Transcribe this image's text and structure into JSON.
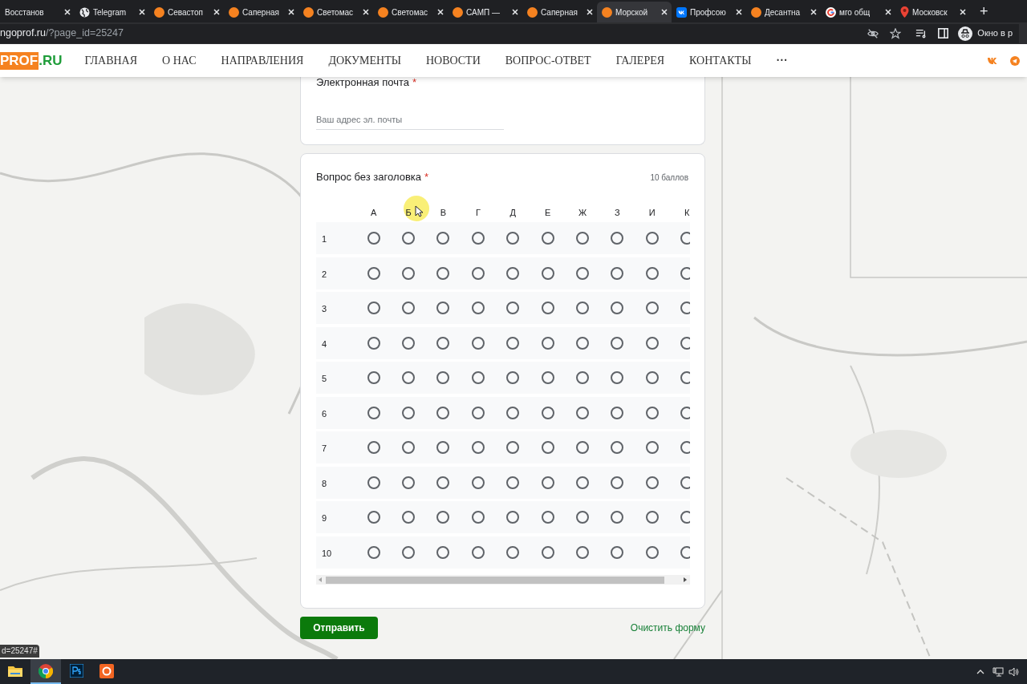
{
  "browser": {
    "tabs": [
      {
        "title": "Восстанов",
        "kind": "none",
        "selected": false
      },
      {
        "title": "Telegram",
        "kind": "globe",
        "selected": false
      },
      {
        "title": "Севастоп",
        "kind": "dot",
        "selected": false
      },
      {
        "title": "Саперная",
        "kind": "dot",
        "selected": false
      },
      {
        "title": "Светомас",
        "kind": "dot",
        "selected": false
      },
      {
        "title": "Светомас",
        "kind": "dot",
        "selected": false
      },
      {
        "title": "САМП —",
        "kind": "dot",
        "selected": false
      },
      {
        "title": "Саперная",
        "kind": "dot",
        "selected": false
      },
      {
        "title": "Морской",
        "kind": "dot",
        "selected": true
      },
      {
        "title": "Профсою",
        "kind": "vk",
        "selected": false
      },
      {
        "title": "Десантна",
        "kind": "dot",
        "selected": false
      },
      {
        "title": "мго общ",
        "kind": "g",
        "selected": false
      },
      {
        "title": "Московск",
        "kind": "pin",
        "selected": false
      }
    ],
    "new_tab": "+",
    "url_host": "ngoprof.ru",
    "url_path": "/?page_id=25247",
    "profile_label": "Окно в р"
  },
  "site": {
    "logo_box": "PROF",
    "logo_rest": ".RU",
    "nav": [
      "ГЛАВНАЯ",
      "О НАС",
      "НАПРАВЛЕНИЯ",
      "ДОКУМЕНТЫ",
      "НОВОСТИ",
      "ВОПРОС-ОТВЕТ",
      "ГАЛЕРЕЯ",
      "КОНТАКТЫ"
    ],
    "more": "···"
  },
  "form": {
    "required_mark": "*",
    "email": {
      "label": "Электронная почта",
      "required": true,
      "placeholder": "Ваш адрес эл. почты"
    },
    "grid": {
      "title": "Вопрос без заголовка",
      "required": true,
      "points": "10 баллов",
      "columns": [
        "А",
        "Б",
        "В",
        "Г",
        "Д",
        "Е",
        "Ж",
        "З",
        "И",
        "К"
      ],
      "rows": [
        {
          "label": "1",
          "checked": [
            false,
            false,
            false,
            false,
            false,
            false,
            false,
            false,
            false,
            false
          ]
        },
        {
          "label": "2",
          "checked": [
            false,
            false,
            false,
            false,
            false,
            false,
            false,
            false,
            false,
            false
          ]
        },
        {
          "label": "3",
          "checked": [
            false,
            false,
            false,
            false,
            false,
            false,
            false,
            false,
            false,
            false
          ]
        },
        {
          "label": "4",
          "checked": [
            false,
            false,
            false,
            false,
            false,
            false,
            false,
            false,
            false,
            false
          ]
        },
        {
          "label": "5",
          "checked": [
            false,
            false,
            false,
            false,
            false,
            false,
            false,
            false,
            false,
            false
          ]
        },
        {
          "label": "6",
          "checked": [
            false,
            false,
            false,
            false,
            false,
            false,
            false,
            false,
            false,
            false
          ]
        },
        {
          "label": "7",
          "checked": [
            false,
            false,
            false,
            false,
            false,
            false,
            false,
            false,
            false,
            false
          ]
        },
        {
          "label": "8",
          "checked": [
            false,
            false,
            false,
            false,
            false,
            false,
            false,
            false,
            false,
            false
          ]
        },
        {
          "label": "9",
          "checked": [
            false,
            false,
            false,
            false,
            false,
            false,
            false,
            false,
            false,
            false
          ]
        },
        {
          "label": "10",
          "checked": [
            false,
            false,
            false,
            false,
            false,
            false,
            false,
            false,
            false,
            false
          ]
        }
      ]
    },
    "submit": "Отправить",
    "clear": "Очистить форму"
  },
  "status_url": "d=25247#",
  "taskbar": [
    {
      "kind": "folder",
      "active": false
    },
    {
      "kind": "chrome",
      "active": true
    },
    {
      "kind": "ps",
      "active": false
    },
    {
      "kind": "app",
      "active": false
    }
  ]
}
